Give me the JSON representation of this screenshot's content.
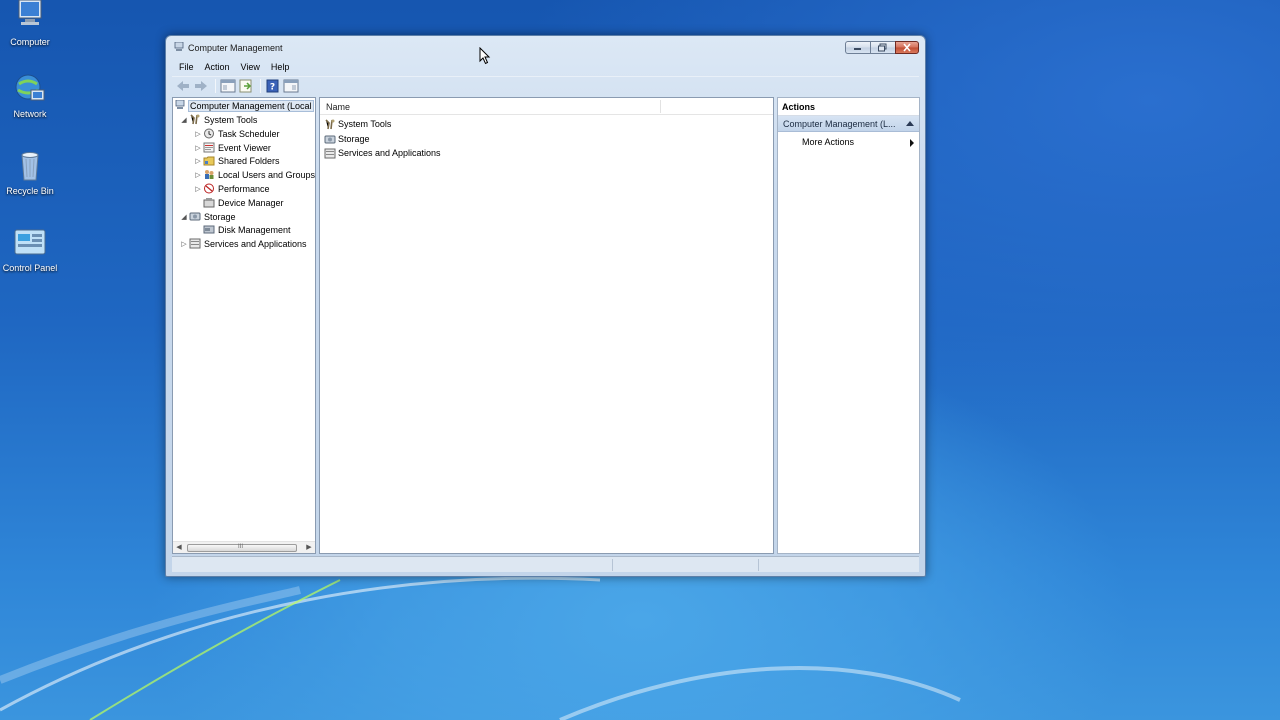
{
  "desktop": {
    "icons": [
      {
        "label": "Computer",
        "icon": "computer-icon"
      },
      {
        "label": "Network",
        "icon": "network-icon"
      },
      {
        "label": "Recycle Bin",
        "icon": "recycle-bin-icon"
      },
      {
        "label": "Control Panel",
        "icon": "control-panel-icon"
      }
    ]
  },
  "window": {
    "title": "Computer Management",
    "menu": [
      "File",
      "Action",
      "View",
      "Help"
    ],
    "toolbar": [
      "back-icon",
      "forward-icon",
      "show-hide-tree-icon",
      "export-list-icon",
      "help-icon",
      "show-hide-action-pane-icon"
    ]
  },
  "tree": {
    "items": [
      {
        "label": "Computer Management (Local",
        "expander": "",
        "icon": "computer-management-icon",
        "selected": true
      },
      {
        "label": "System Tools",
        "expander": "◢",
        "icon": "system-tools-icon"
      },
      {
        "label": "Task Scheduler",
        "expander": "▷",
        "icon": "task-scheduler-icon"
      },
      {
        "label": "Event Viewer",
        "expander": "▷",
        "icon": "event-viewer-icon"
      },
      {
        "label": "Shared Folders",
        "expander": "▷",
        "icon": "shared-folders-icon"
      },
      {
        "label": "Local Users and Groups",
        "expander": "▷",
        "icon": "local-users-icon"
      },
      {
        "label": "Performance",
        "expander": "▷",
        "icon": "performance-icon"
      },
      {
        "label": "Device Manager",
        "expander": "",
        "icon": "device-manager-icon"
      },
      {
        "label": "Storage",
        "expander": "◢",
        "icon": "storage-icon"
      },
      {
        "label": "Disk Management",
        "expander": "",
        "icon": "disk-management-icon"
      },
      {
        "label": "Services and Applications",
        "expander": "▷",
        "icon": "services-applications-icon"
      }
    ]
  },
  "list": {
    "column_name": "Name",
    "rows": [
      {
        "label": "System Tools",
        "icon": "system-tools-icon"
      },
      {
        "label": "Storage",
        "icon": "storage-icon"
      },
      {
        "label": "Services and Applications",
        "icon": "services-applications-icon"
      }
    ]
  },
  "actions": {
    "header": "Actions",
    "section": "Computer Management (L...",
    "items": [
      {
        "label": "More Actions"
      }
    ]
  },
  "scroll": {
    "thumb_glyph": "III",
    "left_arrow": "◀",
    "right_arrow": "▶"
  },
  "colors": {
    "accent": "#c3d5ea",
    "desktop": "#1f67c2",
    "selection": "#dfe8f3"
  }
}
